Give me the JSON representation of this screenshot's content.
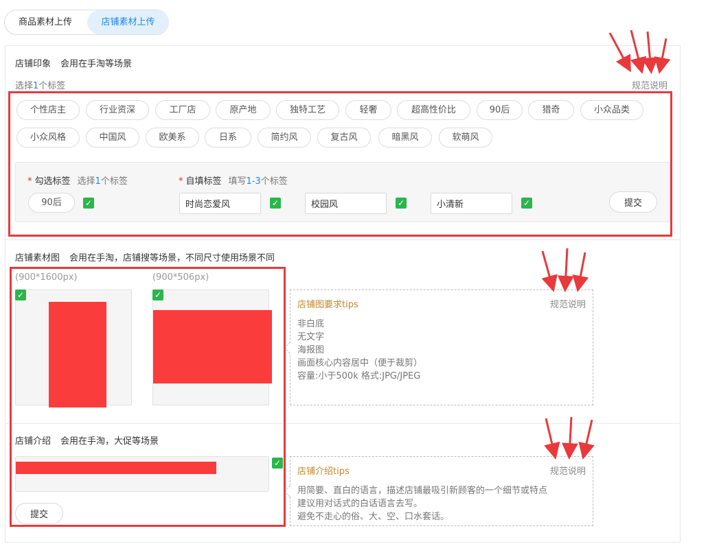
{
  "tabs": [
    "商品素材上传",
    "店铺素材上传"
  ],
  "impression": {
    "title": "店铺印象",
    "desc": "会用在手淘等场景",
    "select_prefix": "选择",
    "select_num": "1",
    "select_suffix": "个标签",
    "spec_link": "规范说明",
    "tags_row1": [
      "个性店主",
      "行业资深",
      "工厂店",
      "原产地",
      "独特工艺",
      "轻奢",
      "超高性价比",
      "90后",
      "猎奇",
      "小众品类"
    ],
    "tags_row2": [
      "小众风格",
      "中国风",
      "欧美系",
      "日系",
      "简约风",
      "复古风",
      "暗黑风",
      "软萌风"
    ],
    "checked_label": "勾选标签",
    "checked_hint_prefix": "选择",
    "checked_hint_num": "1",
    "checked_hint_suffix": "个标签",
    "checked_tag": "90后",
    "custom_label": "自填标签",
    "custom_hint_prefix": "填写",
    "custom_hint_num": "1-3",
    "custom_hint_suffix": "个标签",
    "custom_values": [
      "时尚恋爱风",
      "校园风",
      "小清新"
    ],
    "submit": "提交"
  },
  "material": {
    "title": "店铺素材图",
    "desc": "会用在手淘，店铺搜等场景，不同尺寸使用场景不同",
    "size1": "(900*1600px)",
    "size2": "(900*506px)",
    "tips_title": "店铺图要求tips",
    "tips_spec": "规范说明",
    "tips_lines": [
      "非白底",
      "无文字",
      "海报图",
      "画面核心内容居中（便于裁剪）",
      "容量:小于500k 格式:JPG/JPEG"
    ]
  },
  "intro": {
    "title": "店铺介绍",
    "desc": "会用在手淘，大促等场景",
    "tips_title": "店铺介绍tips",
    "tips_spec": "规范说明",
    "tips_lines": [
      "用简要、直白的语言，描述店铺最吸引新顾客的一个细节或特点",
      "建议用对话式的白话语言去写。",
      "避免不走心的俗、大、空、口水套话。"
    ],
    "submit": "提交"
  },
  "colors": {
    "accent_blue": "#1e88e5",
    "annotation_red": "#e8393c",
    "check_green": "#2bb64b",
    "tips_title": "#c4872d"
  }
}
